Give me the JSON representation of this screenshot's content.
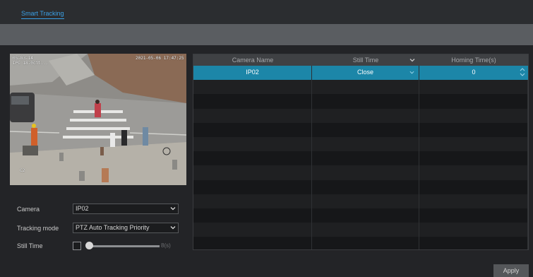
{
  "header": {
    "tab_title": "Smart Tracking"
  },
  "preview": {
    "osd_top_left": "05-83-14\nIPC 18-0cll...",
    "osd_top_right": "2021-05-06 17:47:25",
    "osd_bottom_left": "C2"
  },
  "form": {
    "camera_label": "Camera",
    "camera_value": "IP02",
    "tracking_mode_label": "Tracking mode",
    "tracking_mode_value": "PTZ Auto Tracking Priority",
    "still_time_label": "Still Time",
    "still_time_checked": false,
    "still_time_slider_value": "8(s)",
    "still_time_fraction": 0.0
  },
  "table": {
    "columns": [
      "Camera Name",
      "Still Time",
      "Homing Time(s)"
    ],
    "rows": [
      {
        "camera_name": "IP02",
        "still_time": "Close",
        "homing_time": "0"
      }
    ],
    "empty_rows": 12
  },
  "buttons": {
    "apply": "Apply"
  },
  "colors": {
    "accent": "#3aa0e6",
    "selected_row": "#1c86a8"
  }
}
